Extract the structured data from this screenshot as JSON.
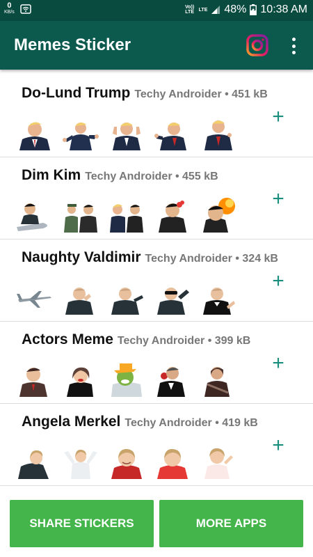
{
  "status_bar": {
    "net_speed": "0",
    "net_unit": "KB/s",
    "volte": "Vo)) LTE",
    "lte": "LTE",
    "battery": "48%",
    "time": "10:38 AM"
  },
  "app_bar": {
    "title": "Memes Sticker"
  },
  "packs": [
    {
      "name": "Do-Lund Trump",
      "meta": "Techy Androider • 451 kB",
      "add": "+"
    },
    {
      "name": "Dim Kim",
      "meta": "Techy Androider • 455 kB",
      "add": "+"
    },
    {
      "name": "Naughty Valdimir",
      "meta": "Techy Androider • 324 kB",
      "add": "+"
    },
    {
      "name": "Actors Meme",
      "meta": "Techy Androider • 399 kB",
      "add": "+"
    },
    {
      "name": "Angela Merkel",
      "meta": "Techy Androider • 419 kB",
      "add": "+"
    }
  ],
  "buttons": {
    "share": "SHARE STICKERS",
    "more": "MORE APPS"
  },
  "colors": {
    "status_bar": "#0a4b40",
    "app_bar": "#0c5a4e",
    "accent": "#1b8f7b",
    "button": "#43b54a"
  }
}
